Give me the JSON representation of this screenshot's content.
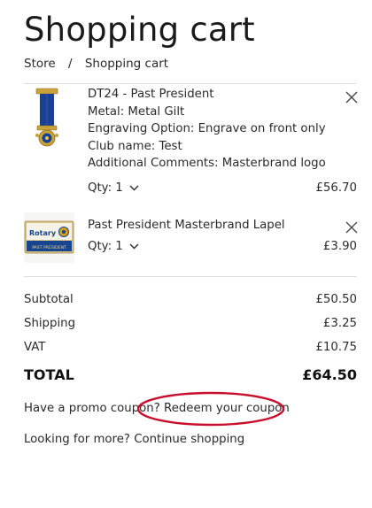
{
  "page": {
    "title": "Shopping cart"
  },
  "breadcrumb": {
    "items": [
      "Store",
      "Shopping cart"
    ],
    "separator": "/"
  },
  "cart": {
    "items": [
      {
        "name": "DT24 - Past President",
        "details": [
          "Metal: Metal Gilt",
          "Engraving Option: Engrave on front only",
          "Club name: Test",
          "Additional Comments: Masterbrand logo"
        ],
        "qty_label": "Qty: 1",
        "price": "£56.70",
        "image": "past-president-medal-image"
      },
      {
        "name": "Past President Masterbrand Lapel",
        "details": [],
        "qty_label": "Qty: 1",
        "price": "£3.90",
        "image": "past-president-lapel-pin-image",
        "image_text_top": "Rotary",
        "image_text_bottom": "PAST PRESIDENT"
      }
    ]
  },
  "summary": {
    "subtotal_label": "Subtotal",
    "subtotal_value": "£50.50",
    "shipping_label": "Shipping",
    "shipping_value": "£3.25",
    "vat_label": "VAT",
    "vat_value": "£10.75",
    "total_label": "TOTAL",
    "total_value": "£64.50"
  },
  "promo": {
    "prefix": "Have a promo coupon?",
    "link": "Redeem your coupon"
  },
  "more": {
    "prefix": "Looking for more?",
    "link": "Continue shopping"
  },
  "colors": {
    "text": "#2a2a2a",
    "divider": "#dedede",
    "annotation_circle": "#c8102e",
    "rotary_blue": "#17458f",
    "rotary_gold": "#d4a017"
  },
  "icons": {
    "remove": "close-icon",
    "qty_dropdown": "chevron-down-icon"
  }
}
